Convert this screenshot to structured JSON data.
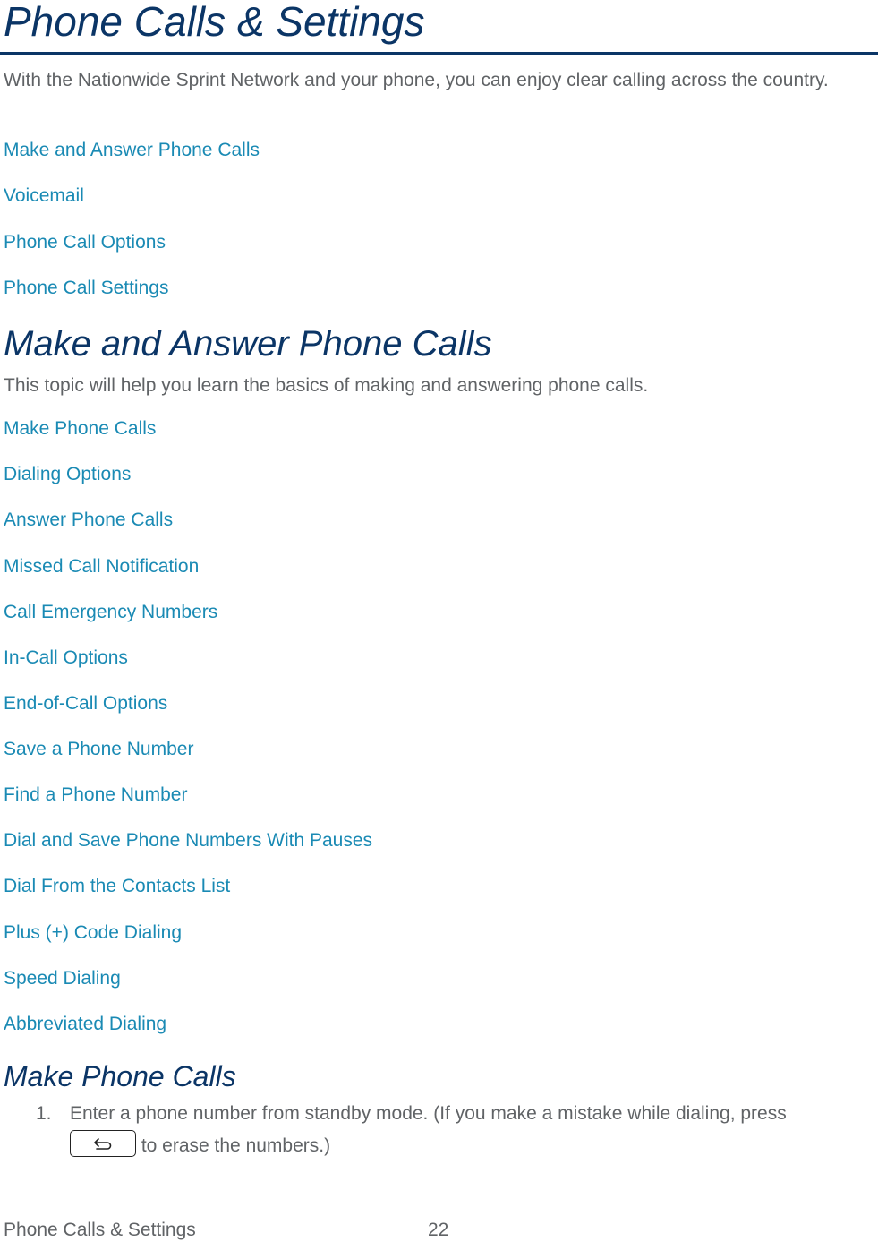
{
  "page": {
    "title": "Phone Calls & Settings",
    "intro": "With the Nationwide Sprint Network and your phone, you can enjoy clear calling across the country.",
    "chapter_links": [
      "Make and Answer Phone Calls",
      "Voicemail",
      "Phone Call Options",
      "Phone Call Settings"
    ]
  },
  "section": {
    "title": "Make and Answer Phone Calls",
    "description": "This topic will help you learn the basics of making and answering phone calls.",
    "topic_links": [
      "Make Phone Calls",
      "Dialing Options",
      "Answer Phone Calls",
      "Missed Call Notification",
      "Call Emergency Numbers",
      "In-Call Options",
      "End-of-Call Options",
      "Save a Phone Number",
      "Find a Phone Number",
      "Dial and Save Phone Numbers With Pauses",
      "Dial From the Contacts List",
      "Plus (+) Code Dialing",
      "Speed Dialing",
      "Abbreviated Dialing"
    ]
  },
  "subsection": {
    "title": "Make Phone Calls",
    "steps": [
      {
        "number": "1.",
        "text_before": "Enter a phone number from standby mode. (If you make a mistake while dialing, press",
        "key_icon": "back-key-icon",
        "key_glyph": "⮌",
        "text_after": " to erase the numbers.)"
      }
    ]
  },
  "footer": {
    "section_name": "Phone Calls & Settings",
    "page_number": "22"
  },
  "colors": {
    "heading": "#0b3566",
    "link": "#1a8ab4",
    "body_text": "#606366"
  }
}
